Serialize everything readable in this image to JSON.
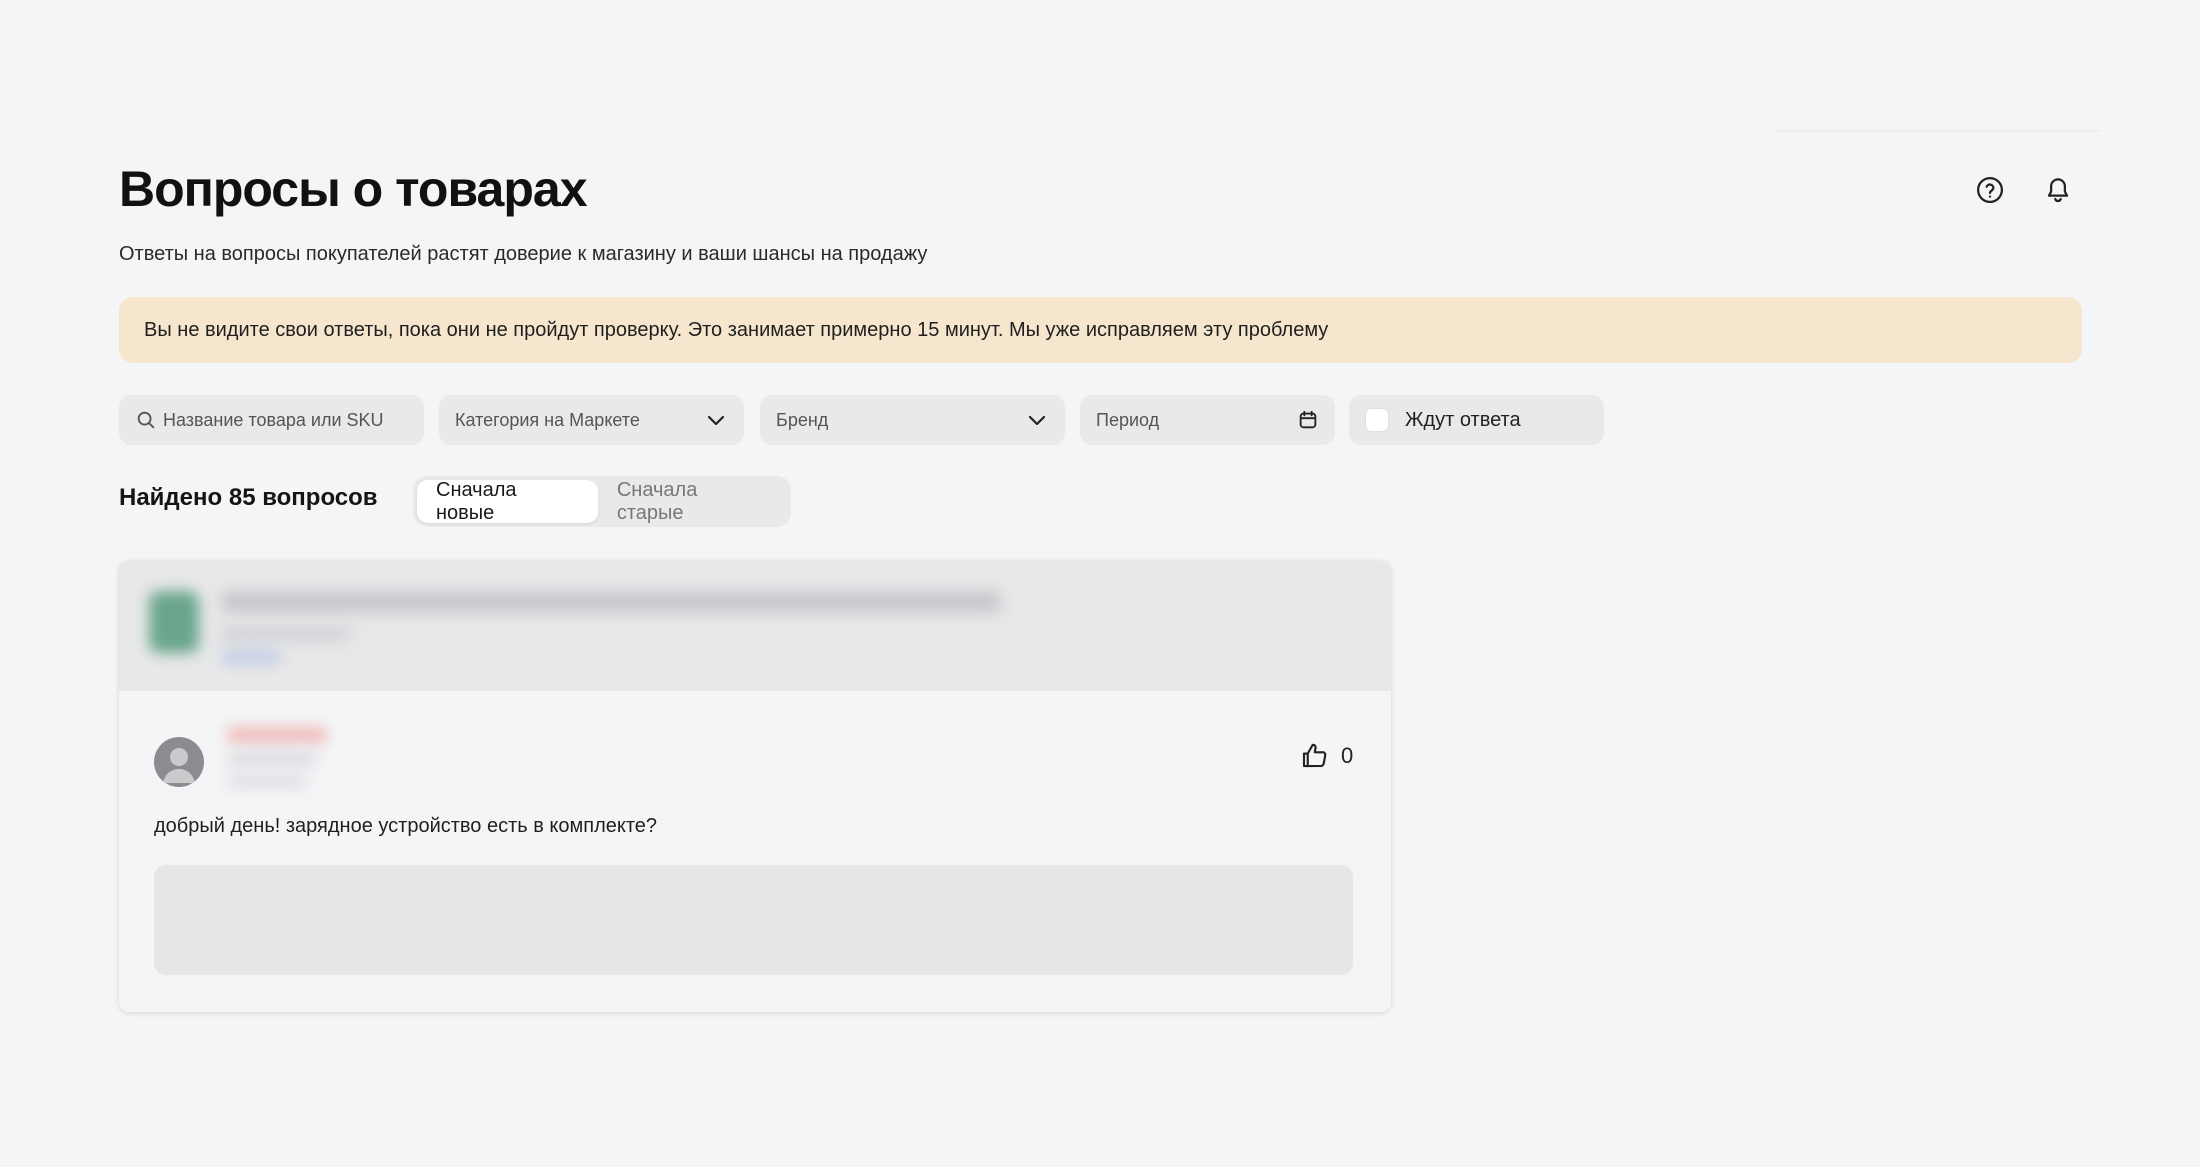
{
  "header": {
    "title": "Вопросы о товарах",
    "subtitle": "Ответы на вопросы покупателей растят доверие к магазину и ваши шансы на продажу",
    "icons": [
      "help-icon",
      "bell-icon"
    ]
  },
  "notice": {
    "text": "Вы не видите свои ответы, пока они не пройдут проверку. Это занимает примерно 15 минут. Мы уже исправляем эту проблему",
    "color": "#f5e6cd"
  },
  "filters": {
    "search_placeholder": "Название товара или SKU",
    "category_label": "Категория на Маркете",
    "brand_label": "Бренд",
    "period_label": "Период",
    "waiting_label": "Ждут ответа",
    "waiting_checked": false
  },
  "results": {
    "found_text": "Найдено 85 вопросов",
    "sort_options": [
      "Сначала новые",
      "Сначала старые"
    ],
    "sort_selected": "Сначала новые"
  },
  "question_card": {
    "question_text": "добрый день! зарядное устройство есть в комплекте?",
    "likes_count": "0"
  }
}
